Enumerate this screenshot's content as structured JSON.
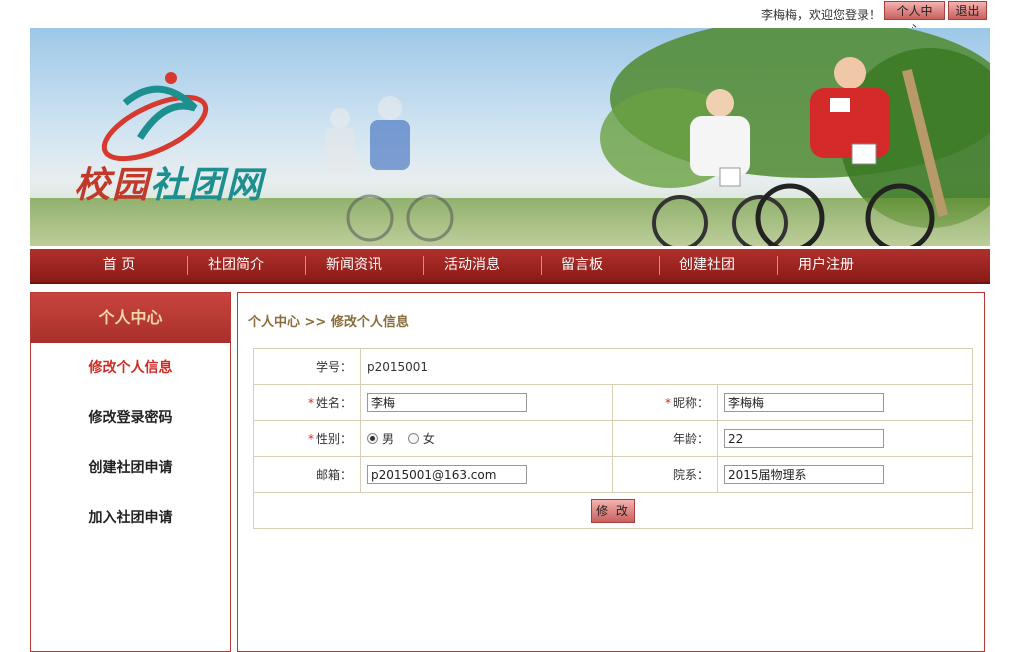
{
  "header": {
    "welcome": "李梅梅，欢迎您登录！",
    "center_btn": "个人中心",
    "logout_btn": "退出"
  },
  "banner": {
    "logo_part1": "校园",
    "logo_part2": "社团网"
  },
  "nav": {
    "items": [
      "首 页",
      "社团简介",
      "新闻资讯",
      "活动消息",
      "留言板",
      "创建社团",
      "用户注册"
    ]
  },
  "sidebar": {
    "title": "个人中心",
    "items": [
      "修改个人信息",
      "修改登录密码",
      "创建社团申请",
      "加入社团申请"
    ]
  },
  "main": {
    "breadcrumb": "个人中心 >> 修改个人信息",
    "form": {
      "student_no_label": "学号：",
      "student_no": "p2015001",
      "name_label": "姓名：",
      "name": "李梅",
      "nickname_label": "昵称：",
      "nickname": "李梅梅",
      "gender_label": "性别：",
      "gender_male": "男",
      "gender_female": "女",
      "age_label": "年龄：",
      "age": "22",
      "email_label": "邮箱：",
      "email": "p2015001@163.com",
      "dept_label": "院系：",
      "dept": "2015届物理系",
      "required_mark": "*",
      "submit": "修 改"
    }
  },
  "colors": {
    "accent": "#a8302b",
    "active_link": "#d12b25"
  }
}
